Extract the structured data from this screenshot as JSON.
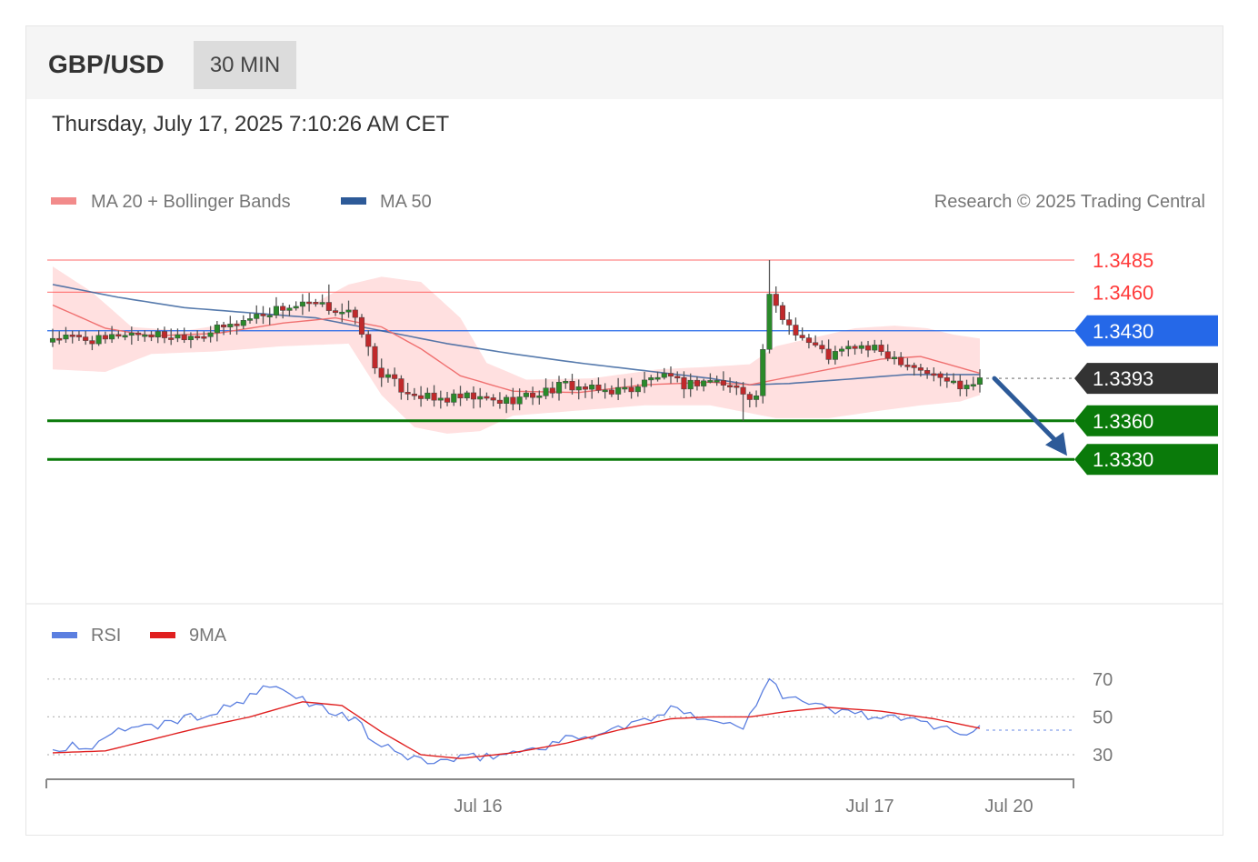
{
  "header": {
    "symbol": "GBP/USD",
    "timeframe": "30 MIN"
  },
  "datetime": "Thursday, July 17, 2025 7:10:26 AM CET",
  "legend": {
    "ma20_label": "MA 20 + Bollinger Bands",
    "ma50_label": "MA 50",
    "credit": "Research © 2025 Trading Central"
  },
  "rsi_legend": {
    "rsi_label": "RSI",
    "ma9_label": "9MA"
  },
  "colors": {
    "ma20": "#f07070",
    "ma50": "#2d5a98",
    "band": "#ffd6d6",
    "bull": "#2a8a2a",
    "bear": "#c0292b",
    "resistance": "#ff3b3b",
    "pivot": "#2568e8",
    "support": "#0a7a0a",
    "last": "#333333",
    "arrow": "#2d5a98",
    "rsi": "#5b7fe0",
    "rsi_ma": "#e02020"
  },
  "chart_data": [
    {
      "type": "candlestick",
      "title": "GBP/USD",
      "ylim": [
        1.332,
        1.35
      ],
      "x_tick_labels": [
        "Jul 16",
        "Jul 17",
        "Jul 20"
      ],
      "price_levels": [
        {
          "value": 1.3485,
          "label": "1.3485",
          "role": "resistance"
        },
        {
          "value": 1.346,
          "label": "1.3460",
          "role": "resistance"
        },
        {
          "value": 1.343,
          "label": "1.3430",
          "role": "pivot"
        },
        {
          "value": 1.3393,
          "label": "1.3393",
          "role": "last"
        },
        {
          "value": 1.336,
          "label": "1.3360",
          "role": "support"
        },
        {
          "value": 1.333,
          "label": "1.3330",
          "role": "support"
        }
      ],
      "forecast_arrow": {
        "from": 1.3393,
        "to": 1.333
      },
      "price_anchors": [
        [
          0,
          1.3425
        ],
        [
          4,
          1.3424
        ],
        [
          8,
          1.3422
        ],
        [
          10,
          1.3428
        ],
        [
          13,
          1.3428
        ],
        [
          18,
          1.3426
        ],
        [
          23,
          1.3428
        ],
        [
          27,
          1.3434
        ],
        [
          31,
          1.3442
        ],
        [
          35,
          1.3448
        ],
        [
          39,
          1.345
        ],
        [
          42,
          1.3448
        ],
        [
          45,
          1.3444
        ],
        [
          47,
          1.343
        ],
        [
          49,
          1.3401
        ],
        [
          53,
          1.3385
        ],
        [
          58,
          1.3376
        ],
        [
          63,
          1.3378
        ],
        [
          68,
          1.3375
        ],
        [
          73,
          1.338
        ],
        [
          78,
          1.3388
        ],
        [
          83,
          1.3383
        ],
        [
          88,
          1.3385
        ],
        [
          92,
          1.3395
        ],
        [
          96,
          1.3388
        ],
        [
          100,
          1.3392
        ],
        [
          104,
          1.3385
        ],
        [
          107,
          1.3378
        ],
        [
          109,
          1.3455
        ],
        [
          111,
          1.344
        ],
        [
          114,
          1.3425
        ],
        [
          118,
          1.341
        ],
        [
          122,
          1.3418
        ],
        [
          126,
          1.3414
        ],
        [
          130,
          1.3405
        ],
        [
          134,
          1.3395
        ],
        [
          138,
          1.3388
        ],
        [
          141,
          1.3393
        ]
      ],
      "ma20_anchors": [
        [
          0,
          1.345
        ],
        [
          8,
          1.3432
        ],
        [
          15,
          1.3426
        ],
        [
          25,
          1.3428
        ],
        [
          35,
          1.3436
        ],
        [
          43,
          1.344
        ],
        [
          50,
          1.3433
        ],
        [
          56,
          1.3416
        ],
        [
          62,
          1.3395
        ],
        [
          70,
          1.3383
        ],
        [
          80,
          1.3382
        ],
        [
          90,
          1.3388
        ],
        [
          100,
          1.339
        ],
        [
          106,
          1.3388
        ],
        [
          110,
          1.3392
        ],
        [
          118,
          1.34
        ],
        [
          126,
          1.3408
        ],
        [
          132,
          1.341
        ],
        [
          141,
          1.3397
        ]
      ],
      "ma50_anchors": [
        [
          0,
          1.3466
        ],
        [
          10,
          1.3456
        ],
        [
          20,
          1.3448
        ],
        [
          30,
          1.3444
        ],
        [
          40,
          1.344
        ],
        [
          50,
          1.343
        ],
        [
          60,
          1.342
        ],
        [
          70,
          1.3412
        ],
        [
          80,
          1.3405
        ],
        [
          90,
          1.3399
        ],
        [
          100,
          1.3393
        ],
        [
          106,
          1.3388
        ],
        [
          112,
          1.3389
        ],
        [
          120,
          1.3392
        ],
        [
          130,
          1.3396
        ],
        [
          141,
          1.3396
        ]
      ],
      "bb_upper_anchors": [
        [
          0,
          1.348
        ],
        [
          6,
          1.346
        ],
        [
          12,
          1.3433
        ],
        [
          20,
          1.343
        ],
        [
          30,
          1.3438
        ],
        [
          40,
          1.3452
        ],
        [
          45,
          1.3466
        ],
        [
          50,
          1.3472
        ],
        [
          56,
          1.3468
        ],
        [
          62,
          1.344
        ],
        [
          66,
          1.3405
        ],
        [
          72,
          1.3392
        ],
        [
          82,
          1.3393
        ],
        [
          92,
          1.34
        ],
        [
          100,
          1.3402
        ],
        [
          106,
          1.3404
        ],
        [
          110,
          1.3418
        ],
        [
          116,
          1.3425
        ],
        [
          122,
          1.3432
        ],
        [
          128,
          1.3434
        ],
        [
          133,
          1.3432
        ],
        [
          137,
          1.3427
        ],
        [
          141,
          1.3424
        ]
      ],
      "bb_lower_anchors": [
        [
          0,
          1.34
        ],
        [
          8,
          1.3398
        ],
        [
          15,
          1.3412
        ],
        [
          25,
          1.3414
        ],
        [
          35,
          1.3418
        ],
        [
          45,
          1.342
        ],
        [
          50,
          1.338
        ],
        [
          55,
          1.3355
        ],
        [
          60,
          1.335
        ],
        [
          65,
          1.3352
        ],
        [
          70,
          1.3364
        ],
        [
          80,
          1.3368
        ],
        [
          90,
          1.3372
        ],
        [
          100,
          1.3372
        ],
        [
          106,
          1.3366
        ],
        [
          110,
          1.3362
        ],
        [
          118,
          1.3362
        ],
        [
          126,
          1.3368
        ],
        [
          132,
          1.3372
        ],
        [
          138,
          1.3375
        ],
        [
          141,
          1.338
        ]
      ]
    },
    {
      "type": "line",
      "title": "RSI",
      "y_tick_labels": [
        "70",
        "50",
        "30"
      ],
      "ylim": [
        20,
        80
      ],
      "series": [
        {
          "name": "RSI",
          "anchors": [
            [
              0,
              32
            ],
            [
              3,
              35
            ],
            [
              6,
              33
            ],
            [
              9,
              40
            ],
            [
              12,
              46
            ],
            [
              15,
              44
            ],
            [
              18,
              48
            ],
            [
              22,
              50
            ],
            [
              26,
              54
            ],
            [
              30,
              60
            ],
            [
              33,
              66
            ],
            [
              36,
              62
            ],
            [
              39,
              58
            ],
            [
              42,
              53
            ],
            [
              45,
              50
            ],
            [
              47,
              45
            ],
            [
              49,
              36
            ],
            [
              53,
              30
            ],
            [
              58,
              26
            ],
            [
              63,
              28
            ],
            [
              68,
              30
            ],
            [
              73,
              33
            ],
            [
              78,
              38
            ],
            [
              83,
              41
            ],
            [
              88,
              46
            ],
            [
              92,
              50
            ],
            [
              95,
              55
            ],
            [
              98,
              51
            ],
            [
              102,
              47
            ],
            [
              105,
              44
            ],
            [
              107,
              58
            ],
            [
              109,
              72
            ],
            [
              111,
              62
            ],
            [
              114,
              58
            ],
            [
              118,
              54
            ],
            [
              122,
              52
            ],
            [
              126,
              50
            ],
            [
              130,
              48
            ],
            [
              134,
              46
            ],
            [
              138,
              42
            ],
            [
              141,
              43
            ]
          ]
        },
        {
          "name": "9MA",
          "anchors": [
            [
              0,
              31
            ],
            [
              8,
              32
            ],
            [
              15,
              38
            ],
            [
              22,
              44
            ],
            [
              30,
              50
            ],
            [
              38,
              58
            ],
            [
              44,
              56
            ],
            [
              50,
              42
            ],
            [
              56,
              30
            ],
            [
              62,
              28
            ],
            [
              70,
              31
            ],
            [
              78,
              36
            ],
            [
              86,
              43
            ],
            [
              94,
              49
            ],
            [
              100,
              50
            ],
            [
              106,
              50
            ],
            [
              112,
              53
            ],
            [
              118,
              55
            ],
            [
              126,
              53
            ],
            [
              134,
              49
            ],
            [
              141,
              44
            ]
          ]
        }
      ]
    }
  ]
}
